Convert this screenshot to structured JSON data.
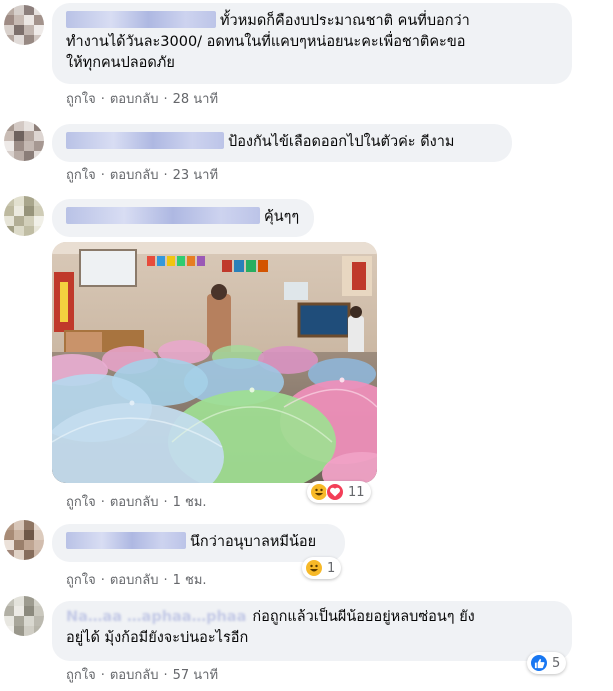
{
  "actions": {
    "like_label": "ถูกใจ",
    "reply_label": "ตอบกลับ",
    "separator": "·"
  },
  "comments": [
    {
      "text_lines": [
        "ทั้วหมดก็คืองบประมาณชาติ คนที่บอกว่า",
        "ทำงานได้วันละ3000/ อดทนในที่แคบๆหน่อยนะคะเพื่อชาติคะขอ",
        "ให้ทุกคนปลอดภัย"
      ],
      "time": "28 นาที"
    },
    {
      "text_lines": [
        "ป้องกันไข้เลือดออกไปในตัวค่ะ ดีงาม"
      ],
      "time": "23 นาที"
    },
    {
      "text_lines": [
        "คุ้นๆๆ"
      ],
      "time": "1 ชม.",
      "has_photo": true,
      "reaction_count": "11",
      "reaction_icons": [
        "haha-icon",
        "love-icon"
      ]
    },
    {
      "text_lines": [
        "นึกว่าอนุบาลหมีน้อย"
      ],
      "time": "1 ชม.",
      "reaction_count": "1",
      "reaction_icons": [
        "haha-icon"
      ]
    },
    {
      "name_text": "Na…aa …aphaa…phaa",
      "text_lines": [
        "ก่อถูกแล้วเป็นผีน้อยอยู่หลบซ่อนๆ ยัง",
        "อยู่ได้ มุ้งก้อมียังจะบ่นอะไรอีก"
      ],
      "time": "57 นาที",
      "reaction_count": "5",
      "reaction_icons": [
        "like-icon"
      ]
    }
  ],
  "colors": {
    "bubble": "#f0f2f5",
    "meta": "#65676b",
    "like_blue": "#1877f2",
    "love_red": "#f33e58",
    "haha_yellow": "#f7b928"
  }
}
